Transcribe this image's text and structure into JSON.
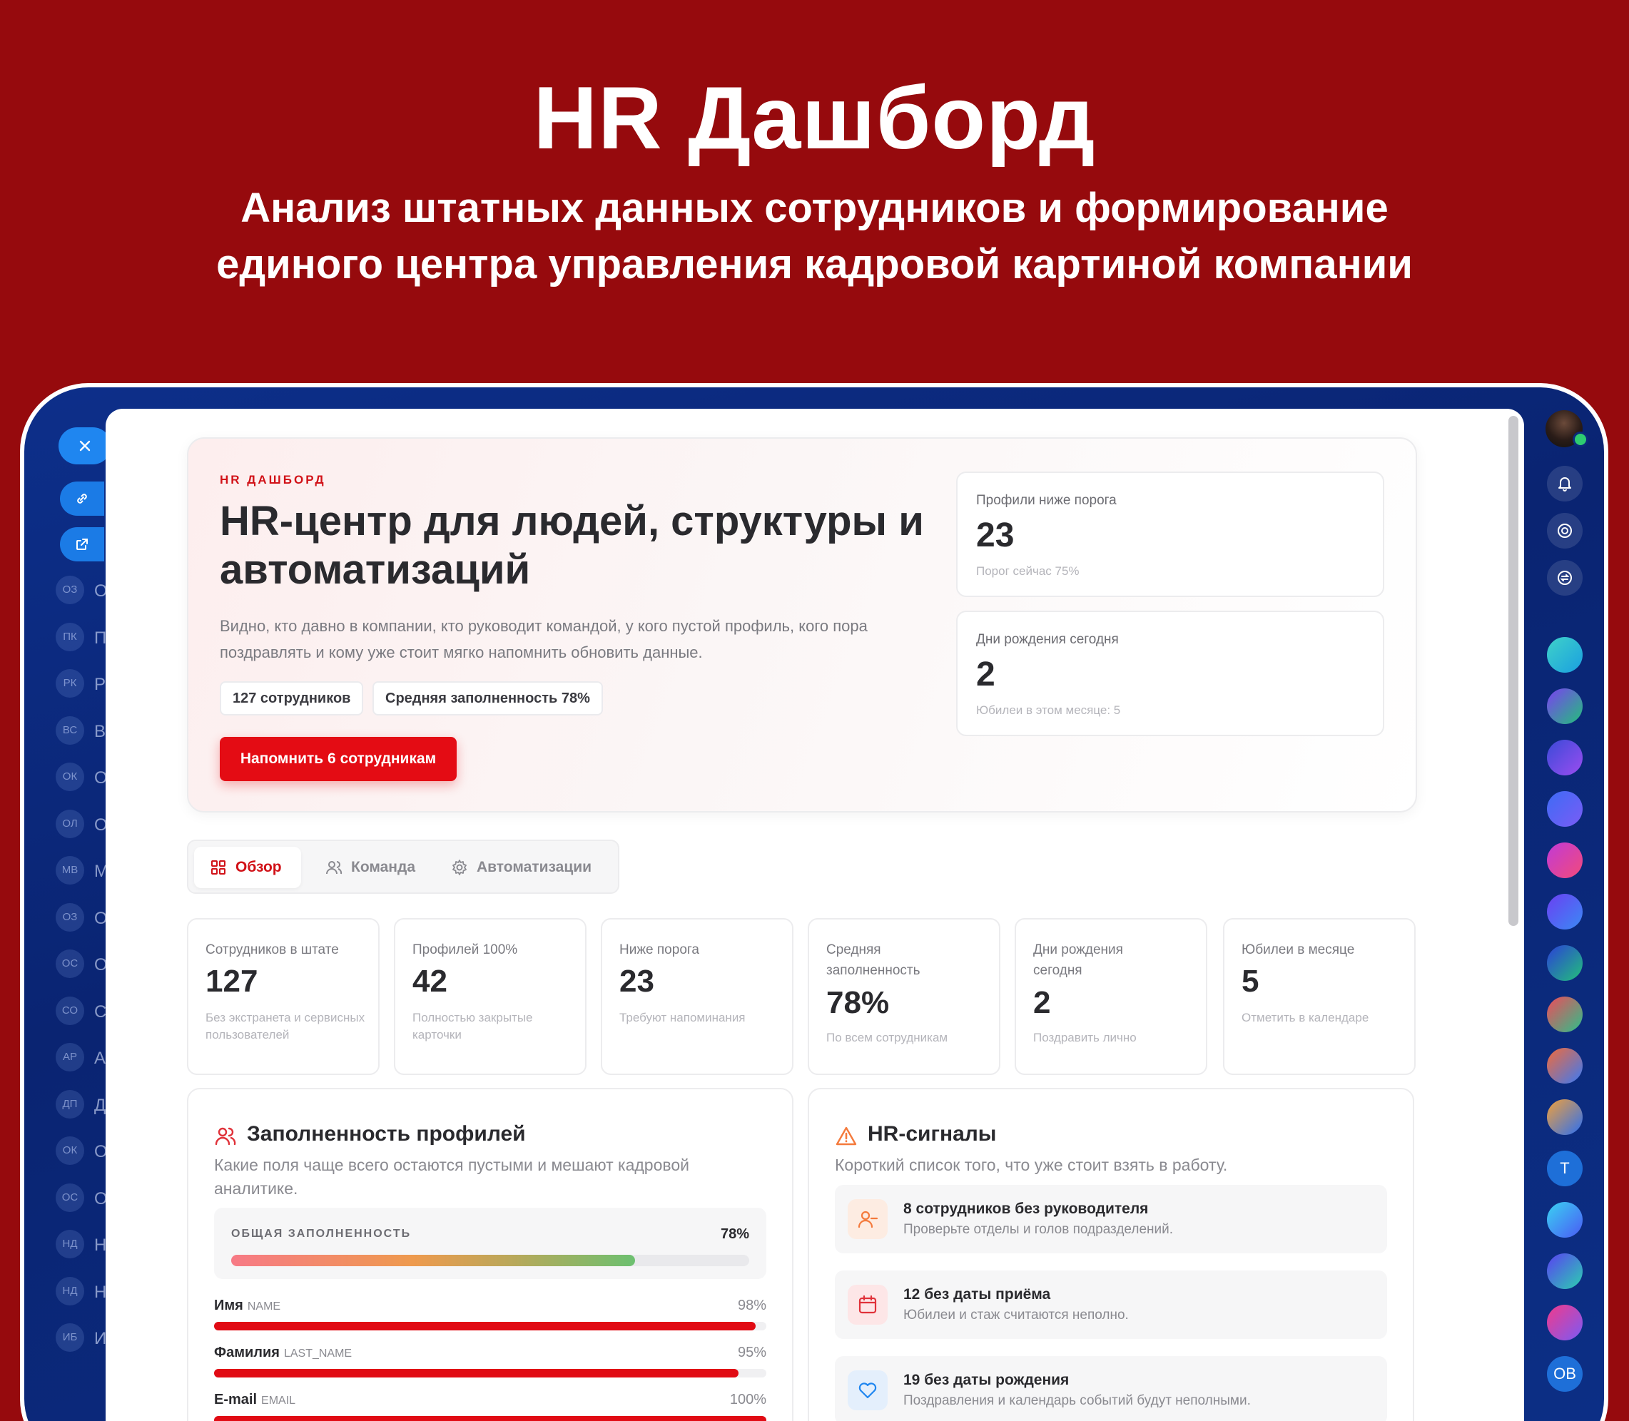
{
  "promo": {
    "title": "HR Дашборд",
    "subtitle": "Анализ штатных данных сотрудников и формирование единого центра управления кадровой картиной компании"
  },
  "sidebar": {
    "items": [
      {
        "initials": "ОЗ",
        "letter": "О"
      },
      {
        "initials": "ПК",
        "letter": "П"
      },
      {
        "initials": "РК",
        "letter": "Р"
      },
      {
        "initials": "ВС",
        "letter": "В"
      },
      {
        "initials": "ОК",
        "letter": "О"
      },
      {
        "initials": "ОЛ",
        "letter": "О"
      },
      {
        "initials": "МВ",
        "letter": "М"
      },
      {
        "initials": "ОЗ",
        "letter": "О"
      },
      {
        "initials": "ОС",
        "letter": "О"
      },
      {
        "initials": "СО",
        "letter": "С"
      },
      {
        "initials": "АР",
        "letter": "А"
      },
      {
        "initials": "ДП",
        "letter": "Д"
      },
      {
        "initials": "ОК",
        "letter": "О"
      },
      {
        "initials": "ОС",
        "letter": "О"
      },
      {
        "initials": "НД",
        "letter": "Н"
      },
      {
        "initials": "НД",
        "letter": "Н"
      },
      {
        "initials": "ИБ",
        "letter": "И"
      }
    ]
  },
  "rail": {
    "text_avatars": [
      "Т",
      "ОВ"
    ]
  },
  "hero": {
    "eyebrow": "HR ДАШБОРД",
    "title": "HR-центр для людей, структуры и автоматизаций",
    "description": "Видно, кто давно в компании, кто руководит командой, у кого пустой профиль, кого пора поздравлять и кому уже стоит мягко напомнить обновить данные.",
    "pills": [
      "127 сотрудников",
      "Средняя заполненность 78%"
    ],
    "cta": "Напомнить 6 сотрудникам",
    "cards": [
      {
        "label": "Профили ниже порога",
        "value": "23",
        "sub": "Порог сейчас 75%"
      },
      {
        "label": "Дни рождения сегодня",
        "value": "2",
        "sub": "Юбилеи в этом месяце: 5"
      }
    ]
  },
  "tabs": [
    {
      "label": "Обзор",
      "active": true,
      "icon": "grid-icon"
    },
    {
      "label": "Команда",
      "active": false,
      "icon": "users-icon"
    },
    {
      "label": "Автоматизации",
      "active": false,
      "icon": "gear-icon"
    }
  ],
  "kpis": [
    {
      "label": "Сотрудников в штате",
      "value": "127",
      "sub": "Без экстранета и сервисных пользователей"
    },
    {
      "label": "Профилей 100%",
      "value": "42",
      "sub": "Полностью закрытые карточки"
    },
    {
      "label": "Ниже порога",
      "value": "23",
      "sub": "Требуют напоминания"
    },
    {
      "label": "Средняя заполненность",
      "value": "78%",
      "sub": "По всем сотрудникам"
    },
    {
      "label": "Дни рождения сегодня",
      "value": "2",
      "sub": "Поздравить лично"
    },
    {
      "label": "Юбилеи в месяце",
      "value": "5",
      "sub": "Отметить в календаре"
    }
  ],
  "profiles": {
    "title": "Заполненность профилей",
    "description": "Какие поля чаще всего остаются пустыми и мешают кадровой аналитике.",
    "overall_label": "ОБЩАЯ ЗАПОЛНЕННОСТЬ",
    "overall_value": "78%",
    "overall_fraction": 0.78,
    "fields": [
      {
        "name": "Имя",
        "code": "NAME",
        "pct": "98%",
        "fraction": 0.98
      },
      {
        "name": "Фамилия",
        "code": "LAST_NAME",
        "pct": "95%",
        "fraction": 0.95
      },
      {
        "name": "E-mail",
        "code": "EMAIL",
        "pct": "100%",
        "fraction": 1.0
      }
    ]
  },
  "signals": {
    "title": "HR-сигналы",
    "description": "Короткий список того, что уже стоит взять в работу.",
    "items": [
      {
        "title": "8 сотрудников без руководителя",
        "desc": "Проверьте отделы и голов подразделений.",
        "icon": "user-minus-icon",
        "color": "#f47a3c"
      },
      {
        "title": "12 без даты приёма",
        "desc": "Юбилеи и стаж считаются неполно.",
        "icon": "calendar-icon",
        "color": "#e0323a"
      },
      {
        "title": "19 без даты рождения",
        "desc": "Поздравления и календарь событий будут неполными.",
        "icon": "heart-icon",
        "color": "#1f86f0"
      }
    ]
  },
  "colors": {
    "brand_red": "#e40c14",
    "background": "#960a0d",
    "device_blue": "#0a2472"
  }
}
